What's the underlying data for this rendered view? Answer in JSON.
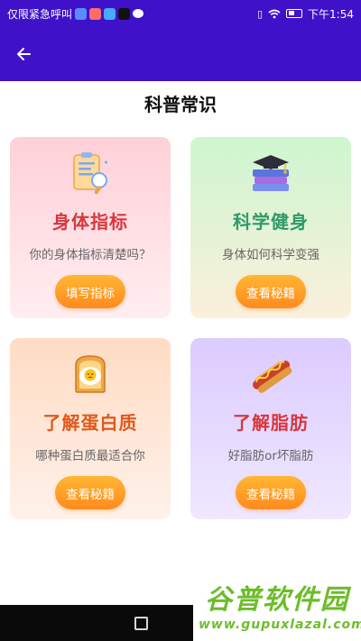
{
  "status_bar": {
    "carrier_text": "仅限紧急呼叫",
    "time": "下午1:54",
    "app_icon_colors": [
      "#5b8cff",
      "#ff6a6a",
      "#49a8ff",
      "#111111",
      "#ffffff"
    ]
  },
  "app_bar": {
    "back_icon": "arrow-left-icon",
    "background": "#3f12c9"
  },
  "page": {
    "title": "科普常识"
  },
  "cards": [
    {
      "icon": "clipboard-icon",
      "title": "身体指标",
      "title_color": "#d9363e",
      "desc": "你的身体指标清楚吗？",
      "button": "填写指标"
    },
    {
      "icon": "books-graduation-cap-icon",
      "title": "科学健身",
      "title_color": "#2e9a6a",
      "desc": "身体如何科学变强",
      "button": "查看秘籍"
    },
    {
      "icon": "egg-toast-icon",
      "title": "了解蛋白质",
      "title_color": "#e0581c",
      "desc": "哪种蛋白质最适合你",
      "button": "查看秘籍"
    },
    {
      "icon": "hotdog-icon",
      "title": "了解脂肪",
      "title_color": "#d9363e",
      "desc": "好脂肪or坏脂肪",
      "button": "查看秘籍"
    }
  ],
  "watermark": {
    "name": "谷普软件园",
    "url": "www.gupuxlazal.com"
  }
}
